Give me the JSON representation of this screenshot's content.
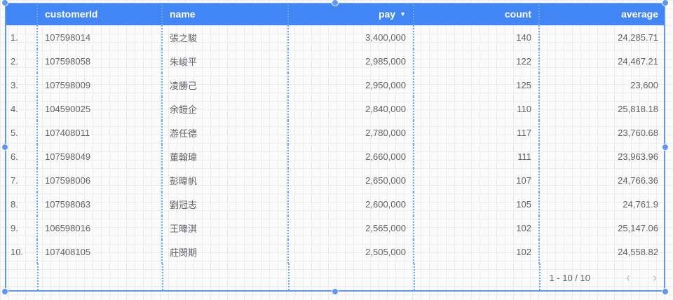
{
  "table": {
    "columns": [
      {
        "key": "rownum",
        "label": "",
        "align": "left"
      },
      {
        "key": "customerId",
        "label": "customerId",
        "align": "left"
      },
      {
        "key": "name",
        "label": "name",
        "align": "left"
      },
      {
        "key": "pay",
        "label": "pay",
        "align": "right",
        "sorted": "desc"
      },
      {
        "key": "count",
        "label": "count",
        "align": "right"
      },
      {
        "key": "average",
        "label": "average",
        "align": "right"
      }
    ],
    "sort_icon": "sort-desc-triangle-icon",
    "rows": [
      {
        "rownum": "1.",
        "customerId": "107598014",
        "name": "張之駿",
        "pay": "3,400,000",
        "count": "140",
        "average": "24,285.71"
      },
      {
        "rownum": "2.",
        "customerId": "107598058",
        "name": "朱峻平",
        "pay": "2,985,000",
        "count": "122",
        "average": "24,467.21"
      },
      {
        "rownum": "3.",
        "customerId": "107598009",
        "name": "凌勝己",
        "pay": "2,950,000",
        "count": "125",
        "average": "23,600"
      },
      {
        "rownum": "4.",
        "customerId": "104590025",
        "name": "余鎧企",
        "pay": "2,840,000",
        "count": "110",
        "average": "25,818.18"
      },
      {
        "rownum": "5.",
        "customerId": "107408011",
        "name": "游任德",
        "pay": "2,780,000",
        "count": "117",
        "average": "23,760.68"
      },
      {
        "rownum": "6.",
        "customerId": "107598049",
        "name": "董翰瑋",
        "pay": "2,660,000",
        "count": "111",
        "average": "23,963.96"
      },
      {
        "rownum": "7.",
        "customerId": "107598006",
        "name": "彭暐帆",
        "pay": "2,650,000",
        "count": "107",
        "average": "24,766.36"
      },
      {
        "rownum": "8.",
        "customerId": "107598063",
        "name": "劉冠志",
        "pay": "2,600,000",
        "count": "105",
        "average": "24,761.9"
      },
      {
        "rownum": "9.",
        "customerId": "106598016",
        "name": "王暐淇",
        "pay": "2,565,000",
        "count": "102",
        "average": "25,147.06"
      },
      {
        "rownum": "10.",
        "customerId": "107408105",
        "name": "莊閔期",
        "pay": "2,505,000",
        "count": "102",
        "average": "24,558.82"
      }
    ]
  },
  "pagination": {
    "range_text": "1 - 10 / 10",
    "prev_icon": "chevron-left-icon",
    "next_icon": "chevron-right-icon"
  },
  "colors": {
    "header_bg": "#4285f4",
    "selection": "#5e97f6",
    "column_guide": "#6aa6f8"
  }
}
